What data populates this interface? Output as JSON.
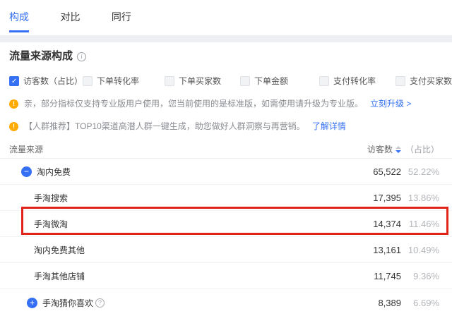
{
  "tabs": [
    {
      "label": "构成",
      "active": true
    },
    {
      "label": "对比",
      "active": false
    },
    {
      "label": "同行",
      "active": false
    }
  ],
  "section": {
    "title": "流量来源构成"
  },
  "metrics": [
    {
      "label": "访客数（占比）",
      "checked": true
    },
    {
      "label": "下单转化率",
      "checked": false
    },
    {
      "label": "下单买家数",
      "checked": false
    },
    {
      "label": "下单金额",
      "checked": false
    },
    {
      "label": "支付转化率",
      "checked": false
    },
    {
      "label": "支付买家数",
      "checked": false
    }
  ],
  "notices": [
    {
      "text": "亲，部分指标仅支持专业版用户使用，您当前使用的是标准版，如需使用请升级为专业版。",
      "link": "立刻升级 >"
    },
    {
      "text": "【人群推荐】TOP10渠道高潜人群一键生成，助您做好人群洞察与再营销。",
      "link": "了解详情"
    }
  ],
  "table": {
    "header": {
      "source": "流量来源",
      "visitors": "访客数",
      "ratio": "（占比）"
    },
    "rows": [
      {
        "label": "淘内免费",
        "visitors": "65,522",
        "ratio": "52.22%"
      },
      {
        "label": "手淘搜索",
        "visitors": "17,395",
        "ratio": "13.86%"
      },
      {
        "label": "手淘微淘",
        "visitors": "14,374",
        "ratio": "11.46%",
        "highlighted": true
      },
      {
        "label": "淘内免费其他",
        "visitors": "13,161",
        "ratio": "10.49%"
      },
      {
        "label": "手淘其他店铺",
        "visitors": "11,745",
        "ratio": "9.36%"
      },
      {
        "label": "手淘猜你喜欢",
        "visitors": "8,389",
        "ratio": "6.69%"
      }
    ]
  },
  "icons": {
    "collapse": "−",
    "expand": "+",
    "notice": "!",
    "info": "i",
    "help": "?",
    "check": "✓"
  },
  "colors": {
    "accent": "#3570f4",
    "highlight_border": "#e2231a",
    "notice_icon": "#ffaa00"
  }
}
